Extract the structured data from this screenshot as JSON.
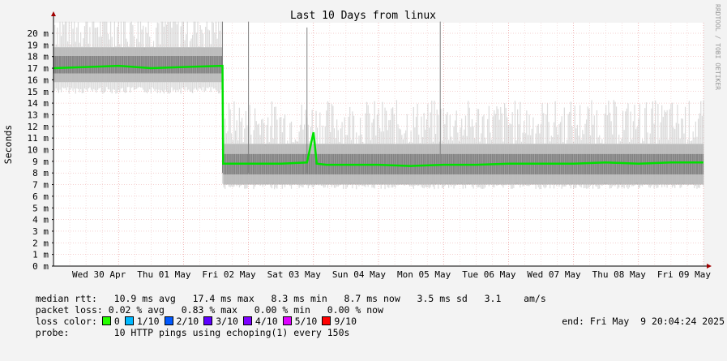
{
  "watermark": "RRDTOOL / TOBI OETIKER",
  "chart_data": {
    "type": "line",
    "title": "Last 10 Days from linux",
    "ylabel": "Seconds",
    "ylim": [
      0,
      21
    ],
    "y_ticks": [
      "0",
      "1",
      "2",
      "3",
      "4",
      "5",
      "6",
      "7",
      "8",
      "9",
      "10",
      "11",
      "12",
      "13",
      "14",
      "15",
      "16",
      "17",
      "18",
      "19",
      "20"
    ],
    "y_tick_suffix": "m",
    "x_ticks": [
      "Wed 30 Apr",
      "Thu 01 May",
      "Fri 02 May",
      "Sat 03 May",
      "Sun 04 May",
      "Mon 05 May",
      "Tue 06 May",
      "Wed 07 May",
      "Thu 08 May",
      "Fri 09 May"
    ],
    "xlim_days": [
      0,
      10
    ],
    "grid": true,
    "series": [
      {
        "name": "median rtt",
        "color": "#00e000",
        "x": [
          0.0,
          0.5,
          1.0,
          1.5,
          2.0,
          2.6,
          2.61,
          3.0,
          3.5,
          3.9,
          4.0,
          4.05,
          4.2,
          4.5,
          5.0,
          5.5,
          6.0,
          6.5,
          7.0,
          7.5,
          8.0,
          8.5,
          9.0,
          9.5,
          10.0
        ],
        "y": [
          17.0,
          17.1,
          17.2,
          17.0,
          17.1,
          17.2,
          8.8,
          8.8,
          8.8,
          8.9,
          11.5,
          8.8,
          8.7,
          8.7,
          8.7,
          8.6,
          8.7,
          8.7,
          8.8,
          8.8,
          8.8,
          8.9,
          8.8,
          8.9,
          8.9
        ]
      }
    ],
    "smoke_band": {
      "color": "#b0b0b0",
      "x": [
        0.0,
        2.6,
        2.61,
        10.0
      ],
      "low": [
        15.8,
        15.8,
        7.0,
        7.0
      ],
      "high": [
        18.8,
        18.8,
        10.5,
        10.5
      ]
    }
  },
  "stats": {
    "rtt_label": "median rtt:",
    "rtt_values": "10.9 ms avg   17.4 ms max   8.3 ms min   8.7 ms now   3.5 ms sd   3.1    am/s",
    "loss_label": "packet loss:",
    "loss_values": "0.02 % avg   0.83 % max   0.00 % min   0.00 % now",
    "color_label": "loss color:",
    "loss_colors": [
      {
        "label": "0",
        "color": "#26ff00"
      },
      {
        "label": "1/10",
        "color": "#00b8ff"
      },
      {
        "label": "2/10",
        "color": "#0059ff"
      },
      {
        "label": "3/10",
        "color": "#5e00ff"
      },
      {
        "label": "4/10",
        "color": "#7e00ff"
      },
      {
        "label": "5/10",
        "color": "#dd00ff"
      },
      {
        "label": "9/10",
        "color": "#ff0000"
      }
    ],
    "probe_label": "probe:",
    "probe_value": "10 HTTP pings using echoping(1) every 150s",
    "end_text": "end: Fri May  9 20:04:24 2025"
  }
}
